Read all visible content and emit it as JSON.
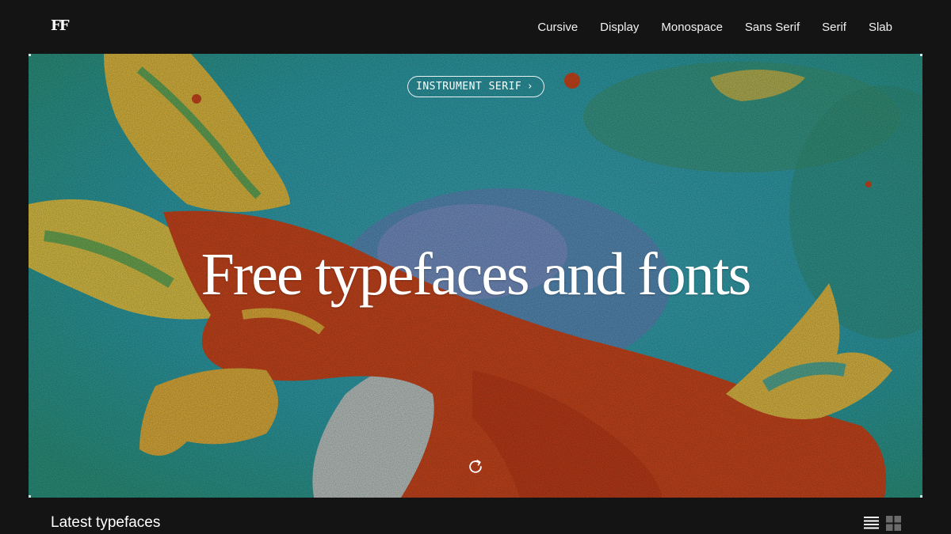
{
  "header": {
    "logo": "FF",
    "nav": [
      {
        "label": "Cursive"
      },
      {
        "label": "Display"
      },
      {
        "label": "Monospace"
      },
      {
        "label": "Sans Serif"
      },
      {
        "label": "Serif"
      },
      {
        "label": "Slab"
      }
    ]
  },
  "hero": {
    "featured_font": "INSTRUMENT SERIF",
    "title": "Free typefaces and fonts",
    "refresh_icon": "refresh-icon"
  },
  "latest": {
    "heading": "Latest typefaces",
    "view_options": [
      {
        "icon": "list-view-icon",
        "active": true
      },
      {
        "icon": "grid-view-icon",
        "active": false
      }
    ]
  }
}
